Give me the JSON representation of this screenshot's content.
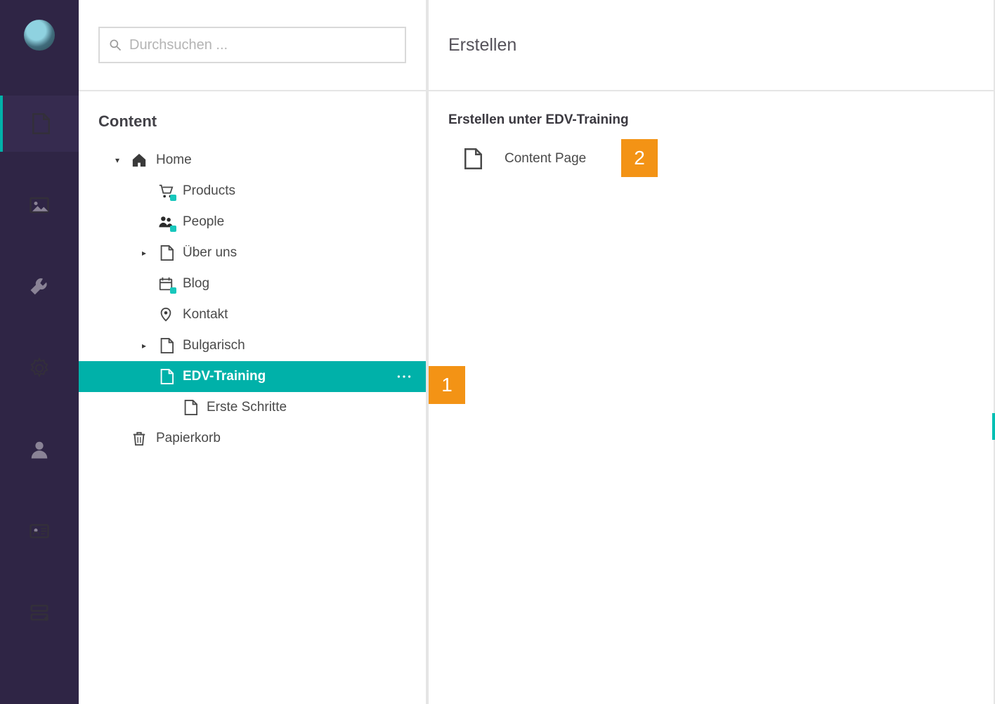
{
  "rail": {
    "items": [
      {
        "name": "content",
        "active": true
      },
      {
        "name": "media",
        "active": false
      },
      {
        "name": "settings-wrench",
        "active": false
      },
      {
        "name": "settings-gear",
        "active": false
      },
      {
        "name": "users",
        "active": false
      },
      {
        "name": "members",
        "active": false
      },
      {
        "name": "forms",
        "active": false
      }
    ]
  },
  "search": {
    "placeholder": "Durchsuchen ..."
  },
  "tree": {
    "title": "Content",
    "nodes": [
      {
        "label": "Home",
        "icon": "home",
        "depth": 0,
        "expanded": true,
        "hasChildren": true,
        "selected": false
      },
      {
        "label": "Products",
        "icon": "cart",
        "depth": 1,
        "expanded": false,
        "hasChildren": false,
        "selected": false
      },
      {
        "label": "People",
        "icon": "people",
        "depth": 1,
        "expanded": false,
        "hasChildren": false,
        "selected": false
      },
      {
        "label": "Über uns",
        "icon": "page",
        "depth": 1,
        "expanded": false,
        "hasChildren": true,
        "selected": false
      },
      {
        "label": "Blog",
        "icon": "calendar",
        "depth": 1,
        "expanded": false,
        "hasChildren": false,
        "selected": false
      },
      {
        "label": "Kontakt",
        "icon": "pin",
        "depth": 1,
        "expanded": false,
        "hasChildren": false,
        "selected": false
      },
      {
        "label": "Bulgarisch",
        "icon": "page",
        "depth": 1,
        "expanded": false,
        "hasChildren": true,
        "selected": false
      },
      {
        "label": "EDV-Training",
        "icon": "page",
        "depth": 1,
        "expanded": true,
        "hasChildren": false,
        "selected": true
      },
      {
        "label": "Erste Schritte",
        "icon": "page",
        "depth": 2,
        "expanded": false,
        "hasChildren": false,
        "selected": false
      },
      {
        "label": "Papierkorb",
        "icon": "trash",
        "depth": 0,
        "expanded": false,
        "hasChildren": false,
        "selected": false
      }
    ]
  },
  "create": {
    "panel_title": "Erstellen",
    "subtitle": "Erstellen unter EDV-Training",
    "options": [
      {
        "label": "Content Page",
        "icon": "page"
      }
    ]
  },
  "callouts": {
    "one": "1",
    "two": "2"
  }
}
